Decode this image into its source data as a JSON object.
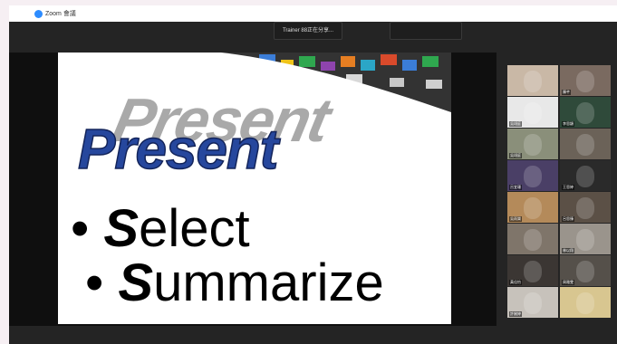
{
  "window": {
    "title": "Zoom 會議"
  },
  "banner": {
    "text": "Trainer 88正在分享..."
  },
  "slide": {
    "title": "Present",
    "bullets": [
      {
        "initial": "S",
        "rest": "elect"
      },
      {
        "initial": "S",
        "rest": "ummarize"
      }
    ]
  },
  "gallery": {
    "participants": [
      {
        "name": "",
        "bg": "#c9b8a6"
      },
      {
        "name": "陳芊",
        "bg": "#7a6a60"
      },
      {
        "name": "吳翊庭",
        "bg": "#e8e8e8"
      },
      {
        "name": "李思穎",
        "bg": "#2f4a3a"
      },
      {
        "name": "吳翊庭",
        "bg": "#8a8f7a"
      },
      {
        "name": "",
        "bg": "#6b6258"
      },
      {
        "name": "呂宜珊",
        "bg": "#4a3f66"
      },
      {
        "name": "王思婷",
        "bg": "#2a2a2a"
      },
      {
        "name": "吳雨樂",
        "bg": "#b48a5a"
      },
      {
        "name": "呂思臻",
        "bg": "#5b5046"
      },
      {
        "name": "",
        "bg": "#7f756a"
      },
      {
        "name": "林以翔",
        "bg": "#9a948c"
      },
      {
        "name": "黃佳怡",
        "bg": "#3b3633"
      },
      {
        "name": "周雅雯",
        "bg": "#55504a"
      },
      {
        "name": "許婉婷",
        "bg": "#c7c2bb"
      },
      {
        "name": "",
        "bg": "#d8c690"
      }
    ]
  }
}
